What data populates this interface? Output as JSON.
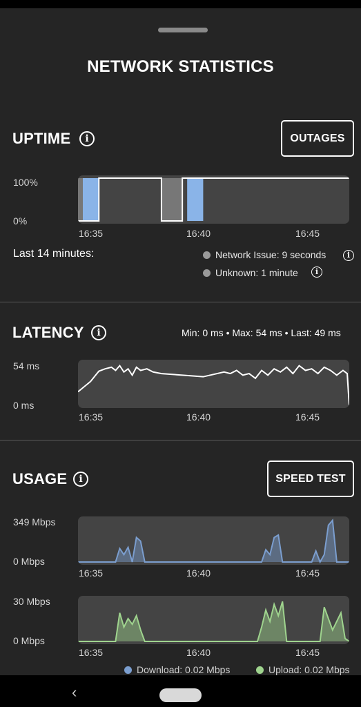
{
  "title": "NETWORK STATISTICS",
  "uptime": {
    "title": "UPTIME",
    "outages_button": "OUTAGES",
    "y_top": "100%",
    "y_bottom": "0%",
    "x_ticks": [
      "16:35",
      "16:40",
      "16:45"
    ],
    "summary_label": "Last 14 minutes:",
    "legend": [
      {
        "label": "Network Issue: 9 seconds"
      },
      {
        "label": "Unknown: 1 minute"
      }
    ]
  },
  "latency": {
    "title": "LATENCY",
    "stats": "Min: 0 ms • Max: 54 ms • Last: 49 ms",
    "y_top": "54 ms",
    "y_bottom": "0 ms",
    "x_ticks": [
      "16:35",
      "16:40",
      "16:45"
    ]
  },
  "usage": {
    "title": "USAGE",
    "speed_test_button": "SPEED TEST",
    "download": {
      "y_top": "349 Mbps",
      "y_bottom": "0 Mbps",
      "x_ticks": [
        "16:35",
        "16:40",
        "16:45"
      ]
    },
    "upload": {
      "y_top": "30 Mbps",
      "y_bottom": "0 Mbps",
      "x_ticks": [
        "16:35",
        "16:40",
        "16:45"
      ]
    },
    "legend_download": "Download: 0.02 Mbps",
    "legend_upload": "Upload: 0.02 Mbps"
  },
  "colors": {
    "download": "#7b9ecf",
    "upload": "#9fd48e",
    "uptime_fill": "#8ab4e8",
    "unknown_fill": "#777777",
    "latency_line": "#ffffff",
    "dot_gray": "#9a9a9a"
  },
  "chart_data": [
    {
      "type": "area",
      "name": "uptime",
      "x": [
        "16:34",
        "16:35",
        "16:36",
        "16:37",
        "16:38",
        "16:39",
        "16:40",
        "16:41",
        "16:42",
        "16:43",
        "16:44",
        "16:45",
        "16:46",
        "16:47"
      ],
      "ylim": [
        0,
        100
      ],
      "series": [
        {
          "values": [
            0,
            100,
            100,
            100,
            0,
            100,
            100,
            100,
            100,
            100,
            100,
            100,
            100,
            100
          ]
        }
      ],
      "unknown_ranges": [
        [
          "16:34",
          "16:35"
        ],
        [
          "16:38",
          "16:39"
        ]
      ],
      "network_issue_ranges": [
        [
          "16:34",
          "16:35"
        ],
        [
          "16:39",
          "16:40"
        ]
      ]
    },
    {
      "type": "line",
      "name": "latency",
      "ylim": [
        0,
        54
      ],
      "x": [
        34.0,
        34.6,
        35.0,
        35.3,
        35.6,
        35.8,
        36.0,
        36.2,
        36.4,
        36.6,
        36.8,
        37.0,
        37.3,
        37.6,
        38.0,
        39.0,
        40.0,
        41.0,
        41.3,
        41.6,
        41.9,
        42.2,
        42.5,
        42.8,
        43.1,
        43.4,
        43.7,
        44.0,
        44.3,
        44.6,
        44.9,
        45.2,
        45.5,
        45.8,
        46.1,
        46.4,
        46.7,
        46.9,
        47.0
      ],
      "y": [
        17,
        30,
        43,
        46,
        48,
        44,
        50,
        42,
        46,
        38,
        48,
        44,
        46,
        42,
        40,
        38,
        36,
        42,
        40,
        44,
        38,
        40,
        34,
        44,
        38,
        46,
        42,
        48,
        40,
        50,
        44,
        46,
        40,
        48,
        44,
        38,
        44,
        40,
        0
      ]
    },
    {
      "type": "area",
      "name": "download",
      "ylim": [
        0,
        349
      ],
      "x": [
        34.0,
        35.8,
        36.0,
        36.2,
        36.4,
        36.6,
        36.8,
        37.0,
        37.2,
        42.8,
        43.0,
        43.2,
        43.4,
        43.6,
        43.8,
        44.0,
        44.2,
        45.2,
        45.4,
        45.6,
        45.8,
        46.0,
        46.2,
        46.4,
        46.6,
        47.0
      ],
      "series": [
        {
          "name": "Download",
          "values": [
            0,
            0,
            110,
            60,
            120,
            0,
            200,
            170,
            0,
            0,
            100,
            60,
            200,
            220,
            0,
            0,
            0,
            0,
            90,
            0,
            60,
            300,
            340,
            0,
            0,
            0
          ]
        }
      ]
    },
    {
      "type": "area",
      "name": "upload",
      "ylim": [
        0,
        30
      ],
      "x": [
        34.0,
        35.8,
        36.0,
        36.2,
        36.4,
        36.6,
        36.8,
        37.0,
        37.2,
        42.6,
        42.8,
        43.0,
        43.2,
        43.4,
        43.6,
        43.8,
        44.0,
        45.6,
        45.8,
        46.0,
        46.2,
        46.4,
        46.6,
        46.8,
        47.0
      ],
      "series": [
        {
          "name": "Upload",
          "values": [
            0,
            0,
            20,
            10,
            16,
            12,
            18,
            8,
            0,
            0,
            10,
            22,
            14,
            26,
            18,
            28,
            0,
            0,
            24,
            16,
            8,
            14,
            20,
            2,
            0
          ]
        }
      ]
    }
  ]
}
